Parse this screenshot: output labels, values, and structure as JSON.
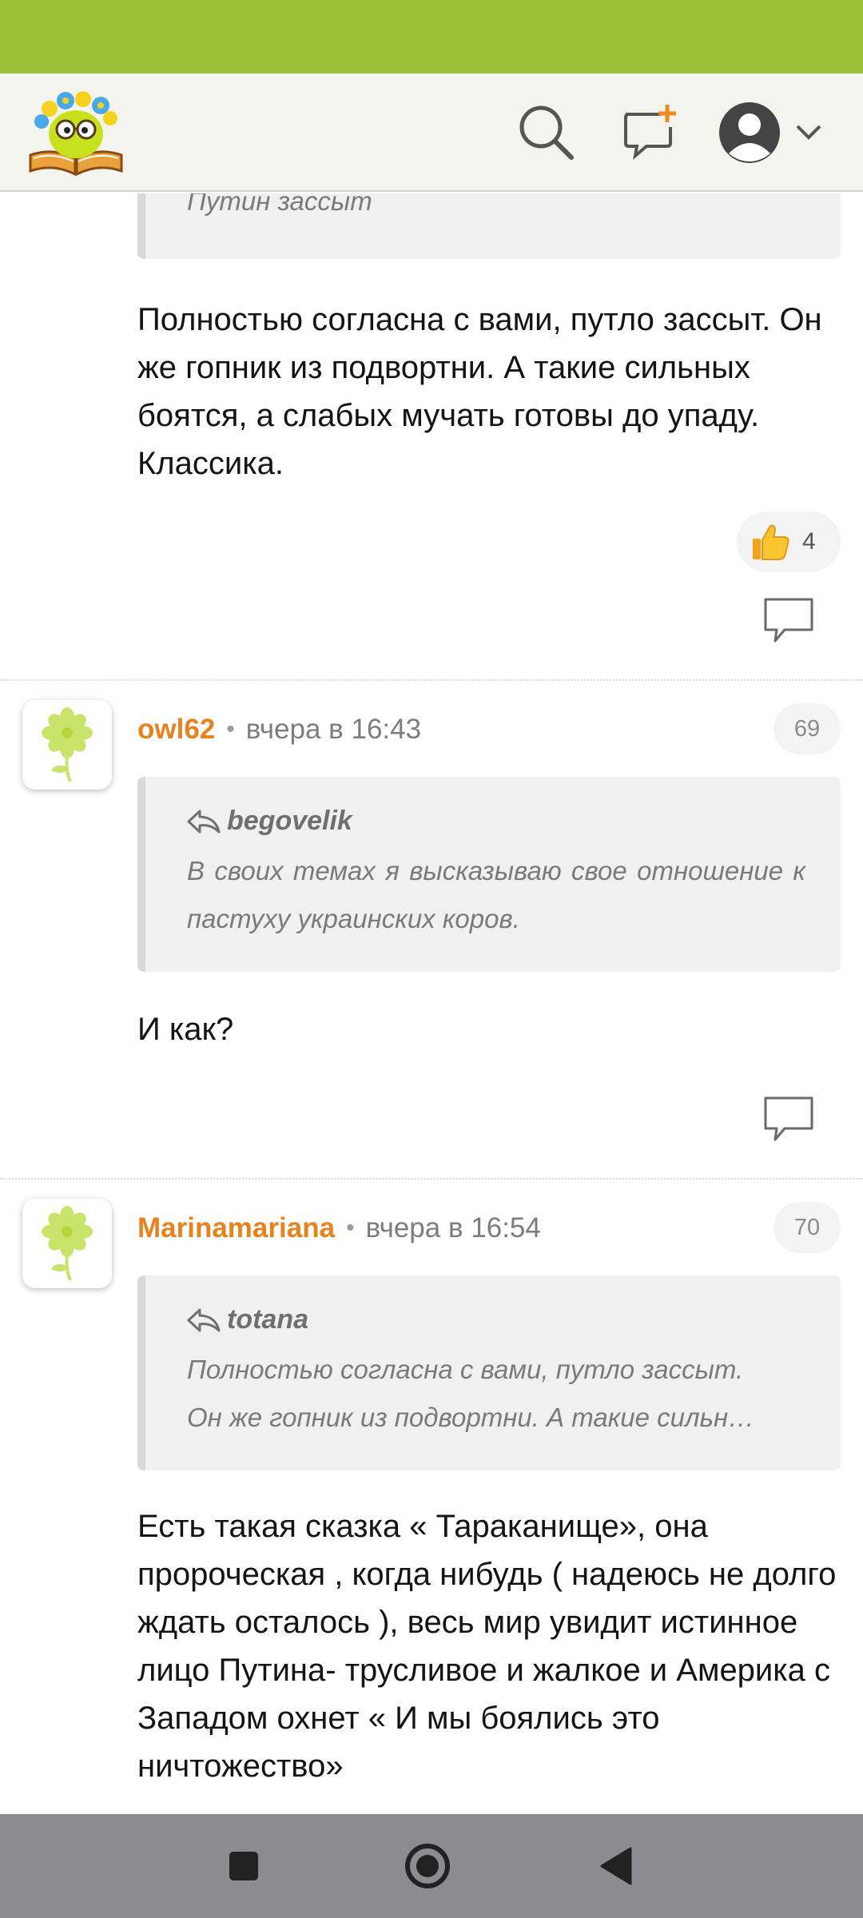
{
  "header": {
    "logo_alt": "site-logo",
    "search_icon": "search-icon",
    "new_post_icon": "new-message-icon",
    "account_icon": "user-avatar-icon"
  },
  "comments": [
    {
      "quote_text": "Путин зассыт",
      "body": "Полностью согласна с вами, путло зассыт. Он же гопник из подвортни. А такие сильных боятся, а слабых мучать готовы до упаду. Классика.",
      "likes": "4"
    },
    {
      "author": "owl62",
      "time": "вчера в 16:43",
      "number": "69",
      "quote_author": "begovelik",
      "quote_text": "В своих темах я высказываю свое отношение к пастуху украинских коров.",
      "body": "И как?"
    },
    {
      "author": "Marinamariana",
      "time": "вчера в 16:54",
      "number": "70",
      "quote_author": "totana",
      "quote_line1": "Полностью согласна с вами, путло зассыт.",
      "quote_line2": "Он же гопник из подвортни. А такие сильн…",
      "body": "Есть такая сказка « Тараканище», она пророческая , когда нибудь ( надеюсь не долго ждать осталось ), весь мир увидит истинное лицо Путина- трусливое и жалкое и Америка с Западом охнет « И мы боялись это ничтожество»"
    }
  ],
  "colors": {
    "status_bar": "#9dc13a",
    "author": "#e8821e",
    "nav_bar": "#8c8c90"
  }
}
